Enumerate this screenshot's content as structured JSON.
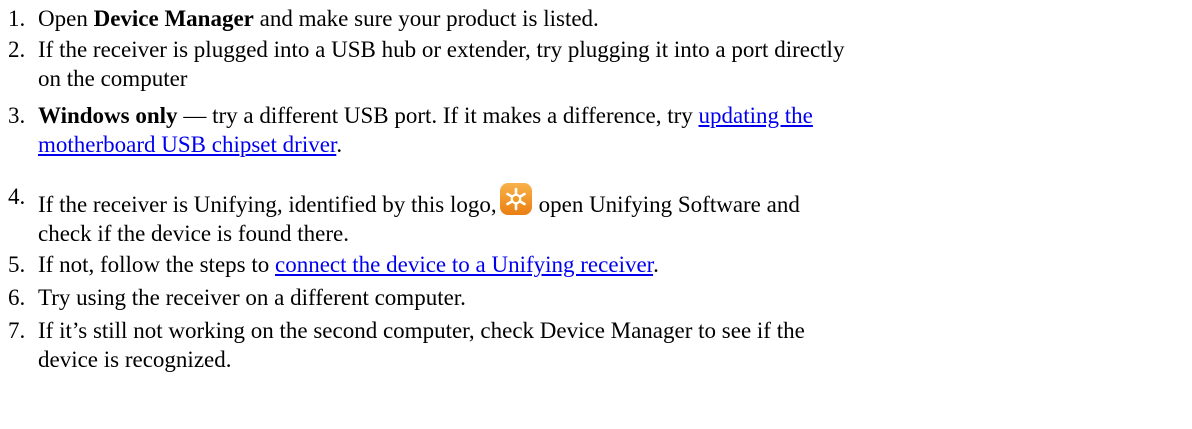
{
  "steps": [
    {
      "number": "1.",
      "pre": "Open ",
      "bold": "Device Manager",
      "post": " and make sure your product is listed."
    },
    {
      "number": "2.",
      "line1": "If the receiver is plugged into a USB hub or extender, try plugging it into a port directly",
      "line2": "on the computer"
    },
    {
      "number": "3.",
      "bold": "Windows only",
      "mid": " — try a different USB port. If it makes a difference, try ",
      "link1": "updating the",
      "link2": "motherboard USB chipset driver",
      "post": "."
    },
    {
      "number": "4.",
      "pre": "If the receiver is Unifying, identified by this logo,",
      "logo_icon": "unifying-logo-icon",
      "post": "open Unifying Software and",
      "line2": "check if the device is found there."
    },
    {
      "number": "5.",
      "pre": "If not, follow the steps to ",
      "link": "connect the device to a Unifying receiver",
      "post": "."
    },
    {
      "number": "6.",
      "text": "Try using the receiver on a different computer."
    },
    {
      "number": "7.",
      "line1": "If it’s still not working on the second computer, check Device Manager to see if the",
      "line2": "device is recognized."
    }
  ],
  "colors": {
    "link": "#0000ee",
    "logo_bg": "#f39a1e"
  }
}
